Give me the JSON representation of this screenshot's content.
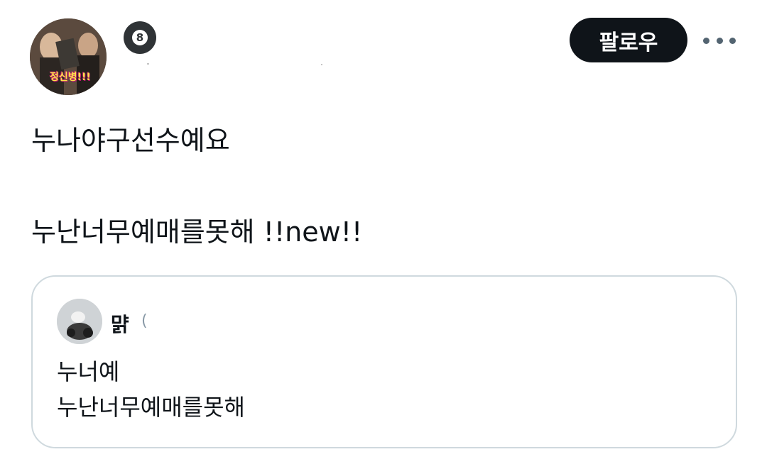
{
  "author": {
    "avatar_caption": "정신병!!!",
    "badge_label": "8"
  },
  "actions": {
    "follow_label": "팔로우",
    "more_icon": "more-horizontal-icon"
  },
  "tweet": {
    "line1": "누나야구선수예요",
    "line2": "누난너무예매를못해 !!new!!"
  },
  "quoted_tweet": {
    "author_name": "먉",
    "author_suffix": "(",
    "line1": "누너예",
    "line2": "누난너무예매를못해"
  },
  "colors": {
    "text": "#0f1419",
    "follow_bg": "#0f1419",
    "border": "#cfd9de",
    "muted": "#536471"
  }
}
